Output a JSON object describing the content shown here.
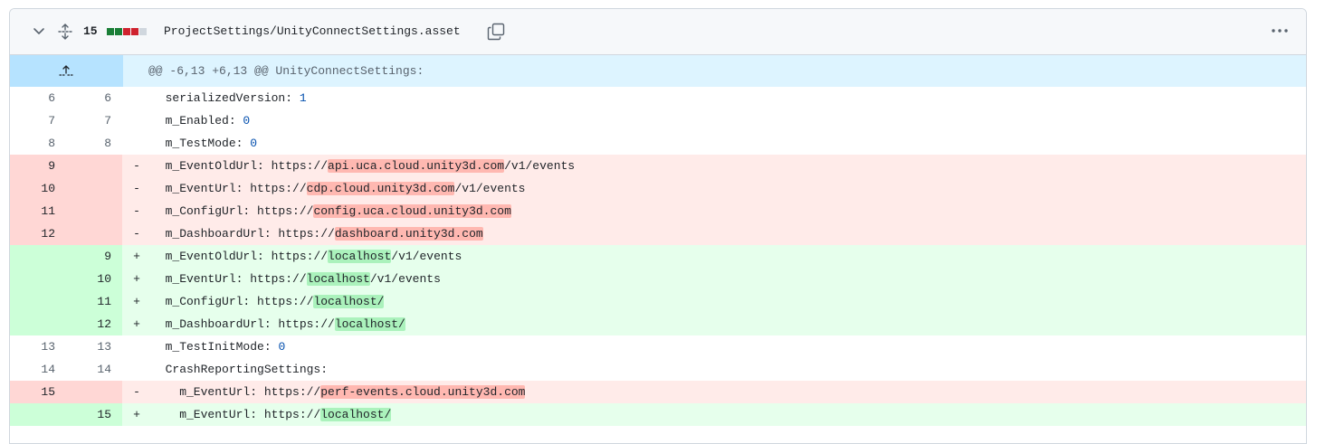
{
  "file": {
    "changes_count": "15",
    "path": "ProjectSettings/UnityConnectSettings.asset",
    "diffstat_colors": [
      "#1a7f37",
      "#1a7f37",
      "#cf222e",
      "#cf222e",
      "#d0d7de"
    ]
  },
  "hunk": {
    "header": "@@ -6,13 +6,13 @@ UnityConnectSettings:"
  },
  "lines": [
    {
      "type": "ctx",
      "old": "6",
      "new": "6",
      "marker": "",
      "pre": "  serializedVersion: ",
      "hl": "",
      "post": "",
      "num": "1"
    },
    {
      "type": "ctx",
      "old": "7",
      "new": "7",
      "marker": "",
      "pre": "  m_Enabled: ",
      "hl": "",
      "post": "",
      "num": "0"
    },
    {
      "type": "ctx",
      "old": "8",
      "new": "8",
      "marker": "",
      "pre": "  m_TestMode: ",
      "hl": "",
      "post": "",
      "num": "0"
    },
    {
      "type": "del",
      "old": "9",
      "new": "",
      "marker": "-",
      "pre": "  m_EventOldUrl: https://",
      "hl": "api.uca.cloud.unity3d.com",
      "post": "/v1/events",
      "num": ""
    },
    {
      "type": "del",
      "old": "10",
      "new": "",
      "marker": "-",
      "pre": "  m_EventUrl: https://",
      "hl": "cdp.cloud.unity3d.com",
      "post": "/v1/events",
      "num": ""
    },
    {
      "type": "del",
      "old": "11",
      "new": "",
      "marker": "-",
      "pre": "  m_ConfigUrl: https://",
      "hl": "config.uca.cloud.unity3d.com",
      "post": "",
      "num": ""
    },
    {
      "type": "del",
      "old": "12",
      "new": "",
      "marker": "-",
      "pre": "  m_DashboardUrl: https://",
      "hl": "dashboard.unity3d.com",
      "post": "",
      "num": ""
    },
    {
      "type": "add",
      "old": "",
      "new": "9",
      "marker": "+",
      "pre": "  m_EventOldUrl: https://",
      "hl": "localhost",
      "post": "/v1/events",
      "num": ""
    },
    {
      "type": "add",
      "old": "",
      "new": "10",
      "marker": "+",
      "pre": "  m_EventUrl: https://",
      "hl": "localhost",
      "post": "/v1/events",
      "num": ""
    },
    {
      "type": "add",
      "old": "",
      "new": "11",
      "marker": "+",
      "pre": "  m_ConfigUrl: https://",
      "hl": "localhost/",
      "post": "",
      "num": ""
    },
    {
      "type": "add",
      "old": "",
      "new": "12",
      "marker": "+",
      "pre": "  m_DashboardUrl: https://",
      "hl": "localhost/",
      "post": "",
      "num": ""
    },
    {
      "type": "ctx",
      "old": "13",
      "new": "13",
      "marker": "",
      "pre": "  m_TestInitMode: ",
      "hl": "",
      "post": "",
      "num": "0"
    },
    {
      "type": "ctx",
      "old": "14",
      "new": "14",
      "marker": "",
      "pre": "  CrashReportingSettings:",
      "hl": "",
      "post": "",
      "num": ""
    },
    {
      "type": "del",
      "old": "15",
      "new": "",
      "marker": "-",
      "pre": "    m_EventUrl: https://",
      "hl": "perf-events.cloud.unity3d.com",
      "post": "",
      "num": ""
    },
    {
      "type": "add",
      "old": "",
      "new": "15",
      "marker": "+",
      "pre": "    m_EventUrl: https://",
      "hl": "localhost/",
      "post": "",
      "num": ""
    }
  ]
}
